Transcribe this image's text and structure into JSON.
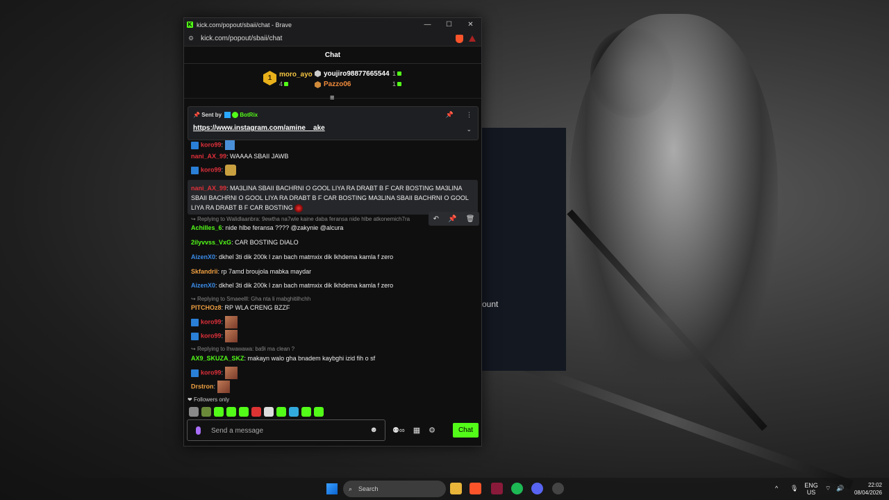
{
  "window": {
    "title": "kick.com/popout/sbaii/chat - Brave",
    "url": "kick.com/popout/sbaii/chat",
    "min": "—",
    "max": "☐",
    "close": "✕"
  },
  "chat": {
    "header": "Chat",
    "leaderboard": {
      "first": {
        "rank": "1",
        "name": "moro_ayo",
        "count": "4"
      },
      "second": {
        "name": "youjiro98877665544",
        "count": "1"
      },
      "third": {
        "name": "Pazzo06",
        "count": "1"
      }
    },
    "pinned": {
      "sent_by": "Sent by",
      "bot_name": "BotRix",
      "link": "https://www.instagram.com/amine__ake"
    },
    "messages": [
      {
        "user": "koro99",
        "text": ""
      },
      {
        "user": "nani_AX_99",
        "text": "WAAAA SBAII JAWB"
      },
      {
        "user": "koro99",
        "text": ""
      },
      {
        "user": "nani_AX_99",
        "text": "MA3LINA SBAII BACHRNI O GOOL LIYA RA DRABT B F CAR BOSTING  MA3LINA SBAII BACHRNI O GOOL LIYA RA DRABT B F CAR BOSTING  MA3LINA SBAII BACHRNI O GOOL LIYA RA DRABT B F CAR BOSTING"
      },
      {
        "reply": "Replying to Walidlaanbra: 9ewtha na7wle kaine daba feransa nide hlbe atkonemich7ra"
      },
      {
        "user": "Achilles_6",
        "text": "nide hlbe feransa ???? @zakynie @alcura"
      },
      {
        "user": "2ilyvvss_VxG",
        "text": "CAR BOSTING DIALO"
      },
      {
        "user": "AizenX0",
        "text": "dkhel 3ti dik 200k l zan bach matmxix dik lkhdema kamla f zero"
      },
      {
        "user": "Skfandrii",
        "text": "rp 7amd broujola mabka maydar"
      },
      {
        "user": "AizenX0",
        "text": "dkhel 3ti dik 200k l zan bach matmxix dik lkhdema kamla f zero"
      },
      {
        "reply": "Replying to Smaeelll: Gha nta li mabghitilhchh"
      },
      {
        "user": "PITCHOz8",
        "text": "RP WLA CRENG BZZF"
      },
      {
        "user": "koro99",
        "text": ""
      },
      {
        "user": "koro99",
        "text": ""
      },
      {
        "reply": "Replying to lhwawawa: ba9i ma clean ?"
      },
      {
        "user": "AX9_SKUZA_SKZ",
        "text": "makayn walo gha bnadem kaybghi izid fih o sf"
      },
      {
        "user": "koro99",
        "text": ""
      },
      {
        "user": "Drstron",
        "text": ""
      }
    ],
    "followers_only": "Followers only",
    "input_placeholder": "Send a message",
    "chat_button": "Chat"
  },
  "background": {
    "partial_text": "ount"
  },
  "taskbar": {
    "search": "Search",
    "lang": "ENG",
    "region": "US",
    "time": "22:02",
    "date": "08/04/2026"
  },
  "colors": {
    "kick_green": "#53fc18",
    "user_red": "#e0303a",
    "user_green": "#53fc18",
    "user_blue": "#3a8ce8",
    "user_orange": "#f0a040"
  }
}
